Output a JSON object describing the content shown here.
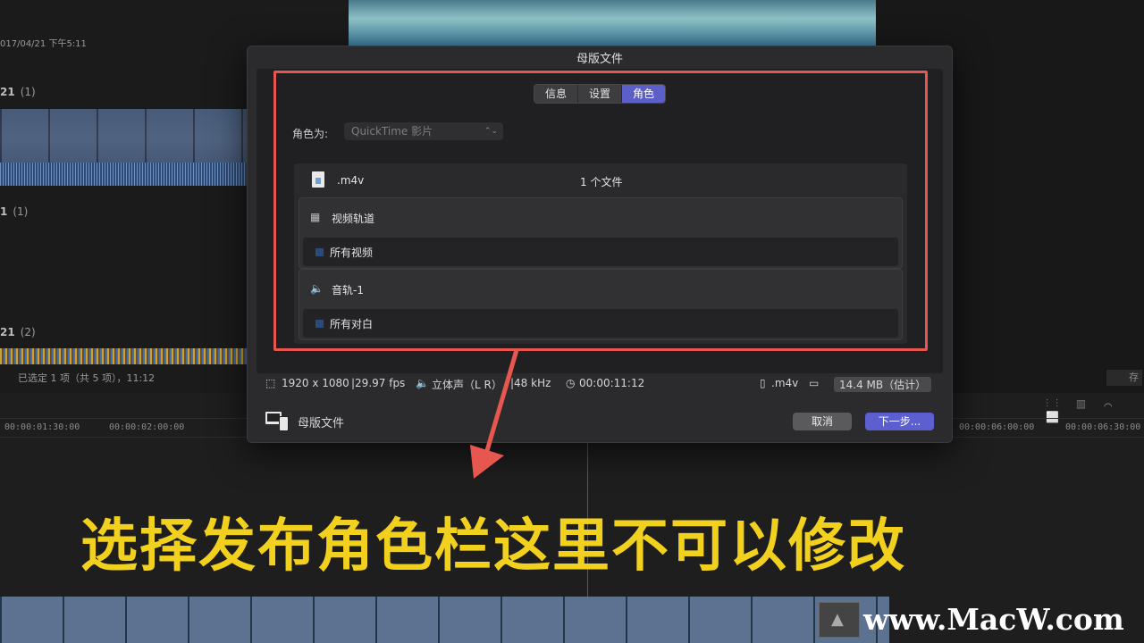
{
  "background": {
    "date": "017/04/21 下午5:11",
    "groups": [
      {
        "name": "21",
        "count": "(1)"
      },
      {
        "name": "1",
        "count": "(1)"
      },
      {
        "name": "21",
        "count": "(2)"
      }
    ],
    "status": "已选定 1 项（共 5 项），11:12",
    "save_partial": "存",
    "timecodes": [
      "00:00:01:30:00",
      "00:00:02:00:00",
      "00:00:06:00:00",
      "00:00:06:30:00"
    ]
  },
  "dialog": {
    "title": "母版文件",
    "tabs": [
      {
        "label": "信息",
        "active": false
      },
      {
        "label": "设置",
        "active": false
      },
      {
        "label": "角色",
        "active": true
      }
    ],
    "role_as_label": "角色为:",
    "role_as_value": "QuickTime 影片",
    "file": {
      "ext": ".m4v",
      "count": "1 个文件"
    },
    "video_track": {
      "name": "视频轨道",
      "icon": "film-icon",
      "role": "所有视频",
      "swatch": "#2b4a7a"
    },
    "audio_track": {
      "name": "音轨-1",
      "icon": "speaker-icon",
      "role": "所有对白",
      "swatch": "#2b4a7a"
    },
    "info": {
      "resolution": "1920 x 1080",
      "fps": "29.97 fps",
      "audio": "立体声（L R）",
      "sample_rate": "48 kHz",
      "duration": "00:00:11:12",
      "file_ext": ".m4v",
      "size": "14.4 MB（估计）"
    },
    "footer_label": "母版文件",
    "cancel_label": "取消",
    "next_label": "下一步..."
  },
  "annotation": {
    "caption": "选择发布角色栏这里不可以修改",
    "highlight_color": "#e8574f",
    "caption_color": "#f1d11e"
  },
  "watermark": "www.MacW.com"
}
